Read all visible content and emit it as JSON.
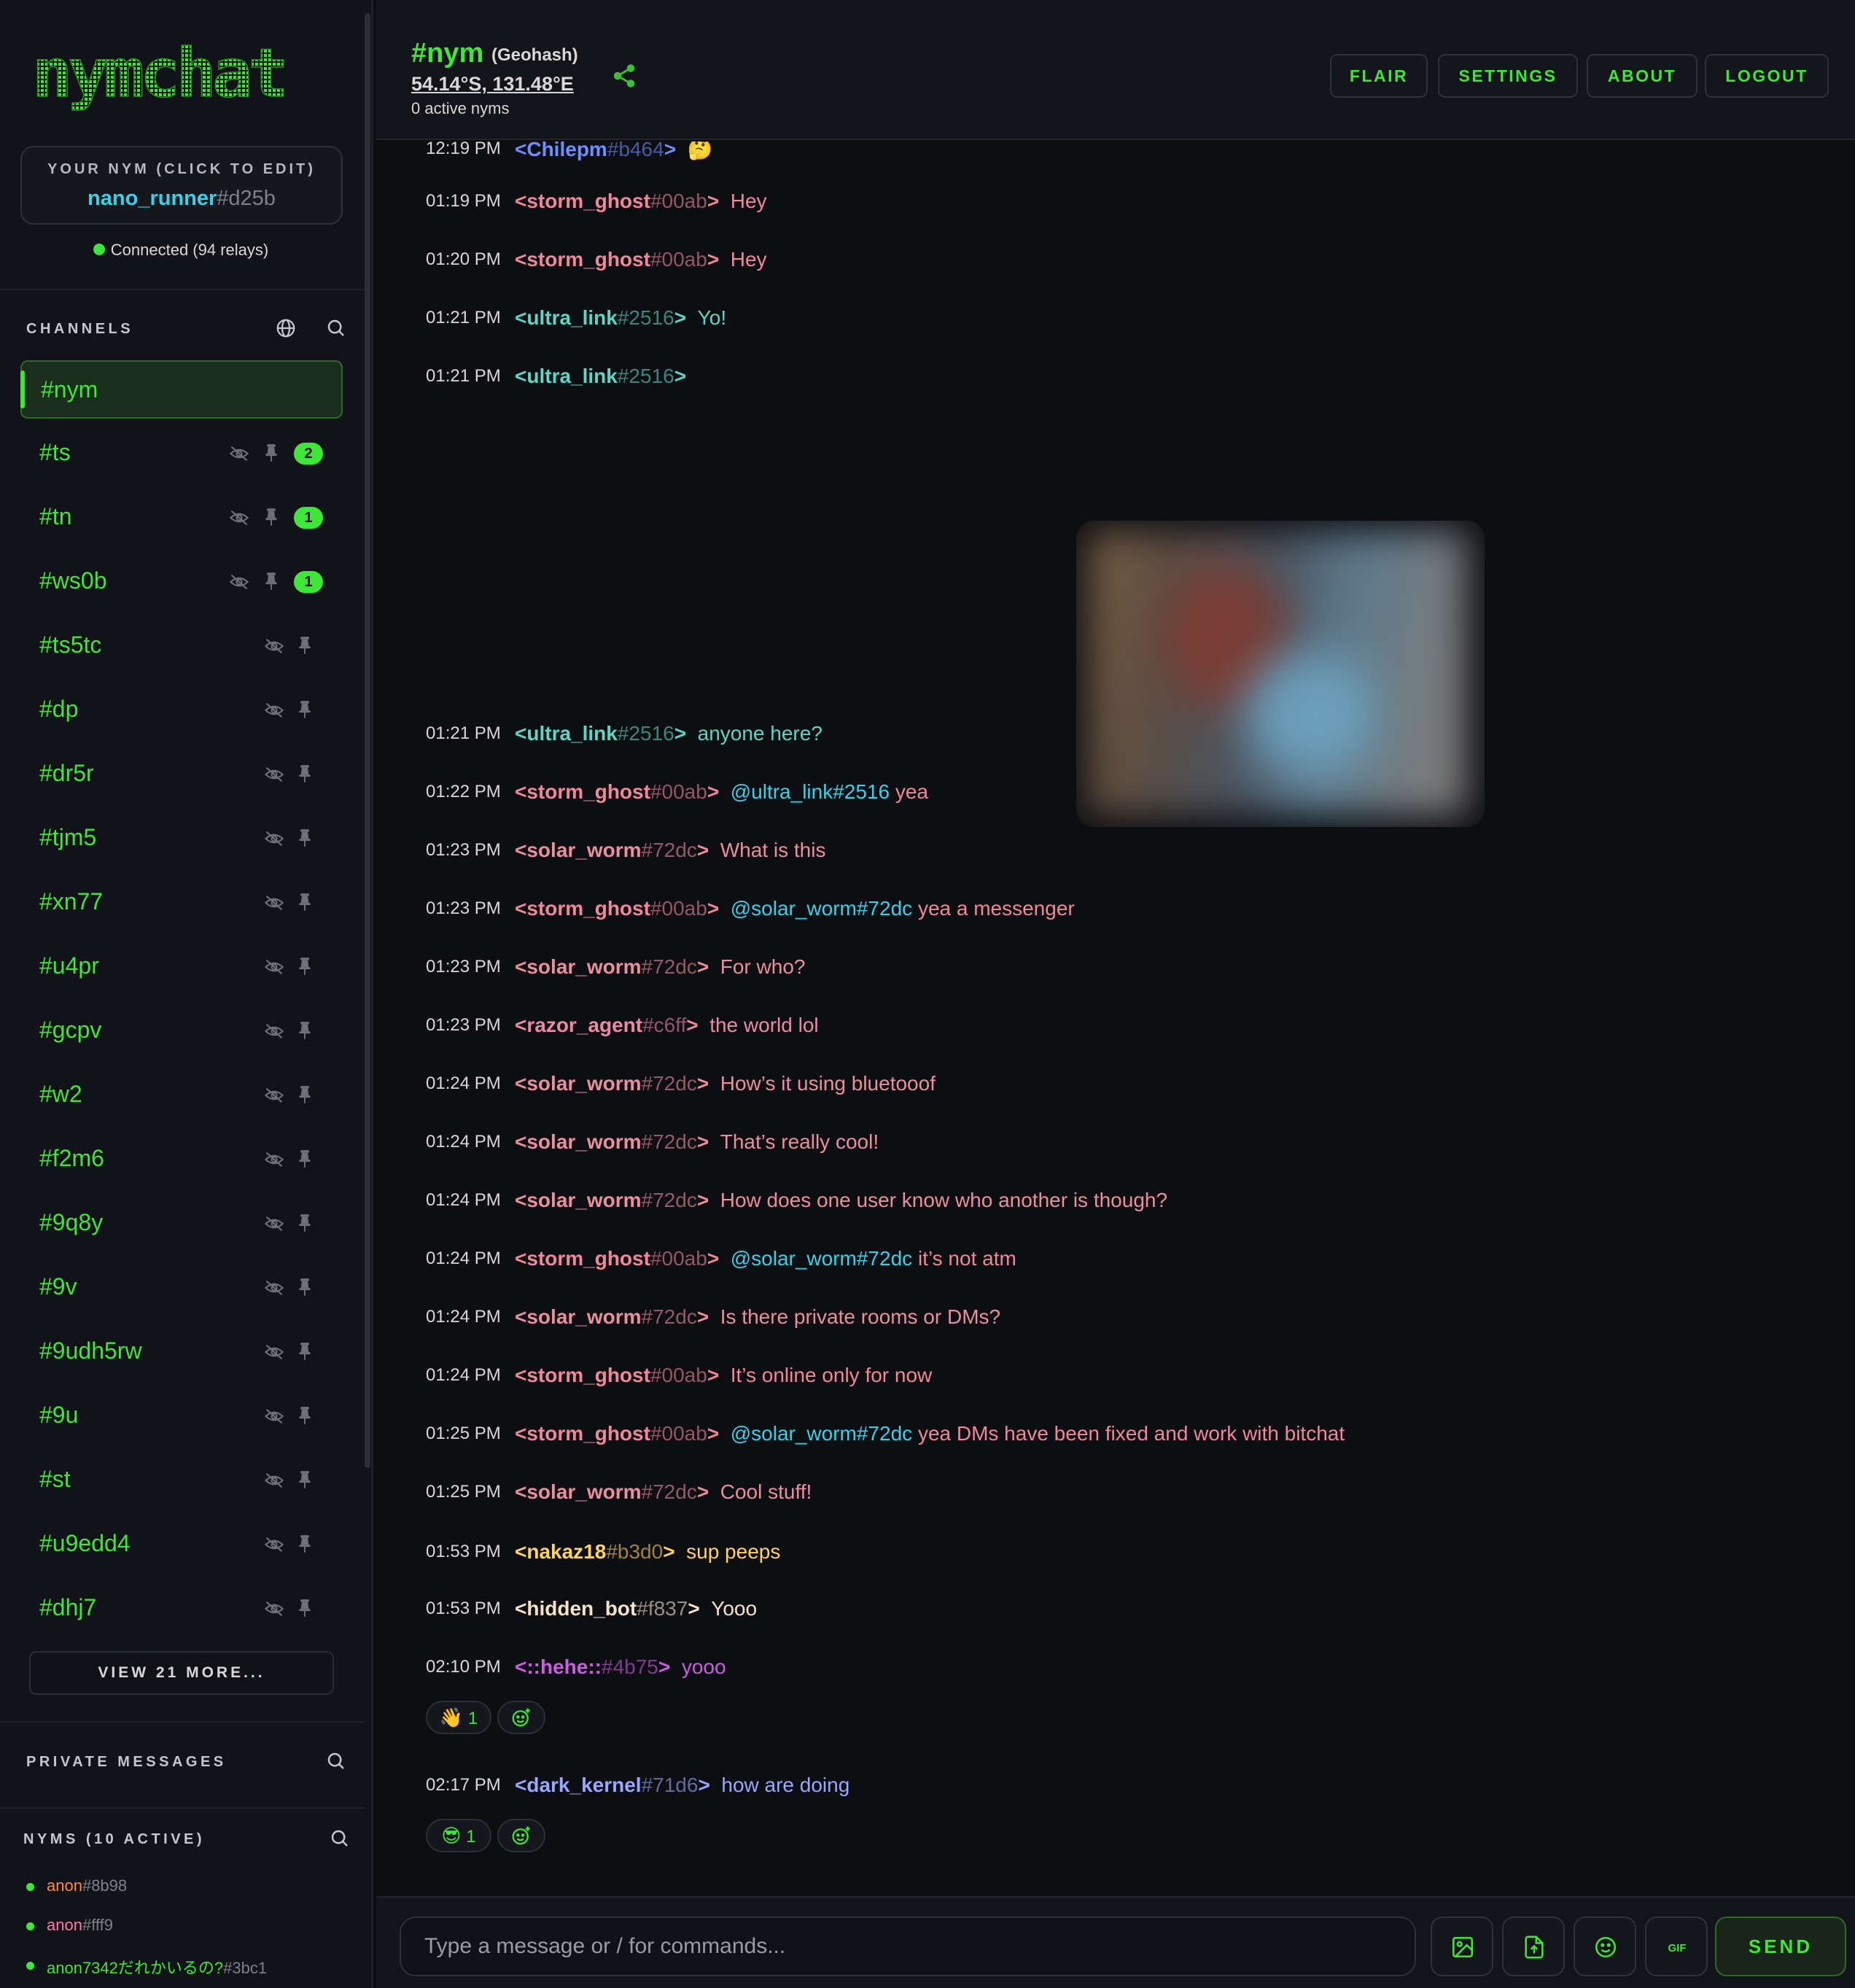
{
  "app": {
    "logo_text": "nymchat"
  },
  "sidebar": {
    "nym_box": {
      "label": "YOUR NYM (CLICK TO EDIT)",
      "name": "nano_runner",
      "tag": "#d25b"
    },
    "connection": "Connected (94 relays)",
    "channels_title": "CHANNELS",
    "channels": [
      {
        "name": "#nym",
        "active": true
      },
      {
        "name": "#ts",
        "badge": "2"
      },
      {
        "name": "#tn",
        "badge": "1"
      },
      {
        "name": "#ws0b",
        "badge": "1"
      },
      {
        "name": "#ts5tc"
      },
      {
        "name": "#dp"
      },
      {
        "name": "#dr5r"
      },
      {
        "name": "#tjm5"
      },
      {
        "name": "#xn77"
      },
      {
        "name": "#u4pr"
      },
      {
        "name": "#gcpv"
      },
      {
        "name": "#w2"
      },
      {
        "name": "#f2m6"
      },
      {
        "name": "#9q8y"
      },
      {
        "name": "#9v"
      },
      {
        "name": "#9udh5rw"
      },
      {
        "name": "#9u"
      },
      {
        "name": "#st"
      },
      {
        "name": "#u9edd4"
      },
      {
        "name": "#dhj7"
      }
    ],
    "view_more": "VIEW 21 MORE...",
    "pm_title": "PRIVATE MESSAGES",
    "nyms_title": "NYMS (10 ACTIVE)",
    "nyms": [
      {
        "name": "anon",
        "tag": "#8b98",
        "color": "#ff8a3d"
      },
      {
        "name": "anon",
        "tag": "#fff9",
        "color": "#ff7aa5"
      },
      {
        "name": "anon7342だれかいるの?",
        "tag": "#3bc1",
        "color": "#3ee637"
      }
    ]
  },
  "header": {
    "channel": "#nym",
    "channel_type": "(Geohash)",
    "coords": "54.14°S, 131.48°E",
    "active": "0 active nyms",
    "buttons": [
      "FLAIR",
      "SETTINGS",
      "ABOUT",
      "LOGOUT"
    ]
  },
  "messages": [
    {
      "time": "12:19 PM",
      "user": "Chilepm",
      "tag": "#b464",
      "text": "🤔",
      "color": "chile"
    },
    {
      "time": "01:19 PM",
      "user": "storm_ghost",
      "tag": "#00ab",
      "text": "Hey",
      "color": "storm"
    },
    {
      "time": "01:20 PM",
      "user": "storm_ghost",
      "tag": "#00ab",
      "text": "Hey",
      "color": "storm"
    },
    {
      "time": "01:21 PM",
      "user": "ultra_link",
      "tag": "#2516",
      "text": "Yo!",
      "color": "ultra"
    },
    {
      "time": "01:21 PM",
      "user": "ultra_link",
      "tag": "#2516",
      "text": "",
      "color": "ultra"
    },
    {
      "time": "01:21 PM",
      "user": "ultra_link",
      "tag": "#2516",
      "text": "anyone here?",
      "color": "ultra"
    },
    {
      "time": "01:22 PM",
      "user": "storm_ghost",
      "tag": "#00ab",
      "mention": "@ultra_link#2516",
      "text": "yea",
      "color": "storm"
    },
    {
      "time": "01:23 PM",
      "user": "solar_worm",
      "tag": "#72dc",
      "text": "What is this",
      "color": "solar"
    },
    {
      "time": "01:23 PM",
      "user": "storm_ghost",
      "tag": "#00ab",
      "mention": "@solar_worm#72dc",
      "text": "yea a messenger",
      "color": "storm"
    },
    {
      "time": "01:23 PM",
      "user": "solar_worm",
      "tag": "#72dc",
      "text": "For who?",
      "color": "solar"
    },
    {
      "time": "01:23 PM",
      "user": "razor_agent",
      "tag": "#c6ff",
      "text": "the world lol",
      "color": "razor"
    },
    {
      "time": "01:24 PM",
      "user": "solar_worm",
      "tag": "#72dc",
      "text": "How’s it using bluetooof",
      "color": "solar"
    },
    {
      "time": "01:24 PM",
      "user": "solar_worm",
      "tag": "#72dc",
      "text": "That’s really cool!",
      "color": "solar"
    },
    {
      "time": "01:24 PM",
      "user": "solar_worm",
      "tag": "#72dc",
      "text": "How does one user know who another is though?",
      "color": "solar"
    },
    {
      "time": "01:24 PM",
      "user": "storm_ghost",
      "tag": "#00ab",
      "mention": "@solar_worm#72dc",
      "text": "it’s not atm",
      "color": "storm"
    },
    {
      "time": "01:24 PM",
      "user": "solar_worm",
      "tag": "#72dc",
      "text": "Is there private rooms or DMs?",
      "color": "solar"
    },
    {
      "time": "01:24 PM",
      "user": "storm_ghost",
      "tag": "#00ab",
      "text": "It’s online only for now",
      "color": "storm"
    },
    {
      "time": "01:25 PM",
      "user": "storm_ghost",
      "tag": "#00ab",
      "mention": "@solar_worm#72dc",
      "text": "yea DMs have been fixed and work with bitchat",
      "color": "storm"
    },
    {
      "time": "01:25 PM",
      "user": "solar_worm",
      "tag": "#72dc",
      "text": "Cool stuff!",
      "color": "solar"
    },
    {
      "time": "01:53 PM",
      "user": "nakaz18",
      "tag": "#b3d0",
      "text": "sup peeps",
      "color": "nakaz"
    },
    {
      "time": "01:53 PM",
      "user": "hidden_bot",
      "tag": "#f837",
      "text": "Yooo",
      "color": "hidden"
    },
    {
      "time": "02:10 PM",
      "user": "::hehe::",
      "tag": "#4b75",
      "text": "yooo",
      "color": "hehe"
    },
    {
      "time": "02:17 PM",
      "user": "dark_kernel",
      "tag": "#71d6",
      "text": "how are doing",
      "color": "dark"
    }
  ],
  "reactions": [
    {
      "emoji": "👋",
      "count": "1"
    },
    {
      "emoji": "😎",
      "count": "1"
    }
  ],
  "input": {
    "placeholder": "Type a message or / for commands...",
    "send_label": "SEND",
    "gif_label": "GIF"
  },
  "colors": {
    "accent": "#3ee637",
    "background": "#0d0e12",
    "mention": "#36d3e8"
  },
  "icons": [
    "globe-icon",
    "search-icon",
    "eye-off-icon",
    "pin-icon",
    "share-icon",
    "image-icon",
    "file-upload-icon",
    "emoji-icon",
    "gif-icon",
    "add-reaction-icon"
  ]
}
